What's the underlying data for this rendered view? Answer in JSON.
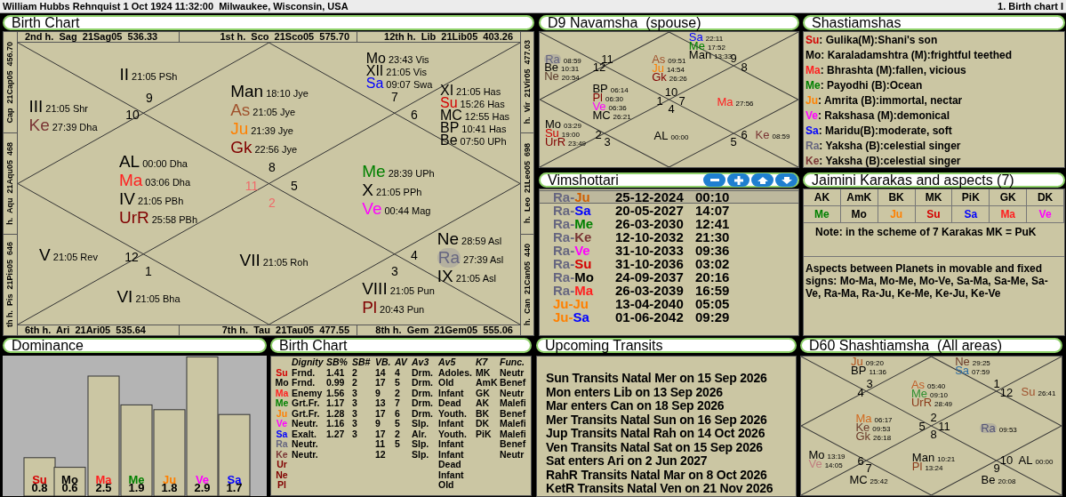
{
  "header": {
    "title": "William Hubbs Rehnquist 1 Oct 1924 11:32:00  Milwaukee, Wisconsin, USA",
    "chart_name": "1. Birth chart I"
  },
  "birth_chart": {
    "title": "Birth Chart",
    "top_labels": [
      "2nd h.  Sag  21Sag05  536.33",
      "1st h.  Sco  21Sco05  575.70",
      "12th h.  Lib  21Lib05  403.26"
    ],
    "bottom_labels": [
      "6th h.  Ari  21Ari05  535.64",
      "7th h.  Tau  21Tau05  477.55",
      "8th h.  Gem  21Gem05  555.06"
    ],
    "left_labels": [
      "Cap  21Cap05  456.70",
      "h.  Aqu  21Aqu05  468",
      "th h.  Pis  21Pis05  646"
    ],
    "right_labels": [
      "h.  Vir  21Vir05  477.03",
      "h.  Leo  21Leo05  698",
      "h.  Can  21Can05  440"
    ],
    "houses": [
      {
        "sign": "9",
        "color": "#000000",
        "planets": [
          {
            "abbr": "II",
            "detail": "21:05 PSh",
            "color": "#000000",
            "highlighted": false
          }
        ]
      },
      {
        "sign": "7",
        "color": "#000000",
        "planets": [
          {
            "abbr": "Mo",
            "detail": "23:43 Vis",
            "color": "#000000",
            "highlighted": false
          },
          {
            "abbr": "XII",
            "detail": "21:05 Vis",
            "color": "#000000",
            "highlighted": false
          },
          {
            "abbr": "Sa",
            "detail": "09:07 Swa",
            "color": "#0000ff",
            "highlighted": false
          }
        ]
      },
      {
        "sign": "10",
        "color": "#000000",
        "planets": [
          {
            "abbr": "III",
            "detail": "21:05 Shr",
            "color": "#000000",
            "highlighted": false
          },
          {
            "abbr": "Ke",
            "detail": "27:39 Dha",
            "color": "#7a3535",
            "highlighted": false
          }
        ]
      },
      {
        "sign": "8",
        "color": "#000000",
        "planets": [
          {
            "abbr": "Man",
            "detail": "18:10 Jye",
            "color": "#000000",
            "highlighted": false
          },
          {
            "abbr": "As",
            "detail": "21:05 Jye",
            "color": "#a0522d",
            "highlighted": false
          },
          {
            "abbr": "Ju",
            "detail": "21:39 Jye",
            "color": "#ff8000",
            "highlighted": false
          },
          {
            "abbr": "Gk",
            "detail": "22:56 Jye",
            "color": "#800000",
            "highlighted": false
          }
        ]
      },
      {
        "sign": "6",
        "color": "#000000",
        "planets": [
          {
            "abbr": "XI",
            "detail": "21:05 Has",
            "color": "#000000",
            "highlighted": false
          },
          {
            "abbr": "Su",
            "detail": "15:26 Has",
            "color": "#d40000",
            "highlighted": false
          },
          {
            "abbr": "MC",
            "detail": "12:55 Has",
            "color": "#000000",
            "highlighted": false
          },
          {
            "abbr": "BP",
            "detail": "10:41 Has",
            "color": "#000000",
            "highlighted": false
          },
          {
            "abbr": "Be",
            "detail": "07:50 UPh",
            "color": "#000000",
            "highlighted": false
          }
        ]
      },
      {
        "sign": "11",
        "color": "#f06a6a",
        "planets": [
          {
            "abbr": "AL",
            "detail": "00:00 Dha",
            "color": "#000000",
            "highlighted": false
          },
          {
            "abbr": "Ma",
            "detail": "03:06 Dha",
            "color": "#ff2020",
            "highlighted": false
          },
          {
            "abbr": "IV",
            "detail": "21:05 PBh",
            "color": "#000000",
            "highlighted": false
          },
          {
            "abbr": "UrR",
            "detail": "25:58 PBh",
            "color": "#800000",
            "highlighted": false
          }
        ]
      },
      {
        "sign": "5",
        "color": "#000000",
        "planets": [
          {
            "abbr": "Me",
            "detail": "28:39 UPh",
            "color": "#008000",
            "highlighted": false
          },
          {
            "abbr": "X",
            "detail": "21:05 PPh",
            "color": "#000000",
            "highlighted": false
          },
          {
            "abbr": "Ve",
            "detail": "00:44 Mag",
            "color": "#ff00ff",
            "highlighted": false
          }
        ]
      },
      {
        "sign": "12",
        "color": "#000000",
        "planets": [
          {
            "abbr": "V",
            "detail": "21:05 Rev",
            "color": "#000000",
            "highlighted": false
          }
        ]
      },
      {
        "sign": "2",
        "color": "#f06a6a",
        "planets": [
          {
            "abbr": "VII",
            "detail": "21:05 Roh",
            "color": "#000000",
            "highlighted": false
          }
        ]
      },
      {
        "sign": "4",
        "color": "#000000",
        "planets": [
          {
            "abbr": "Ne",
            "detail": "28:59 Asl",
            "color": "#000000",
            "highlighted": false
          },
          {
            "abbr": "Ra",
            "detail": "27:39 Asl",
            "color": "#666680",
            "highlighted": true
          },
          {
            "abbr": "IX",
            "detail": "21:05 Asl",
            "color": "#000000",
            "highlighted": false
          }
        ]
      },
      {
        "sign": "1",
        "color": "#000000",
        "planets": [
          {
            "abbr": "VI",
            "detail": "21:05 Bha",
            "color": "#000000",
            "highlighted": false
          }
        ]
      },
      {
        "sign": "3",
        "color": "#000000",
        "planets": [
          {
            "abbr": "VIII",
            "detail": "21:05 Pun",
            "color": "#000000",
            "highlighted": false
          },
          {
            "abbr": "Pl",
            "detail": "20:43 Pun",
            "color": "#800000",
            "highlighted": false
          }
        ]
      }
    ]
  },
  "d9": {
    "title": "D9 Navamsha  (spouse)",
    "houses": [
      {
        "sign": "11",
        "color": "#000000"
      },
      {
        "sign": "9",
        "color": "#000000",
        "planets": [
          {
            "abbr": "Sa",
            "detail": "22:11",
            "color": "#0000ff",
            "highlighted": false
          },
          {
            "abbr": "Me",
            "detail": "17:52",
            "color": "#008000",
            "highlighted": false
          },
          {
            "abbr": "Man",
            "detail": "13:33",
            "color": "#000000",
            "highlighted": false
          }
        ]
      },
      {
        "sign": "12",
        "color": "#000000",
        "planets": [
          {
            "abbr": "Ra",
            "detail": "08:59",
            "color": "#666680",
            "highlighted": true
          },
          {
            "abbr": "Be",
            "detail": "10:31",
            "color": "#000000",
            "highlighted": false
          },
          {
            "abbr": "Ne",
            "detail": "20:54",
            "color": "#5a3a2a",
            "highlighted": false
          }
        ]
      },
      {
        "sign": "10",
        "color": "#000000",
        "planets": [
          {
            "abbr": "As",
            "detail": "09:51",
            "color": "#a0522d",
            "highlighted": false
          },
          {
            "abbr": "Ju",
            "detail": "14:54",
            "color": "#ff8000",
            "highlighted": false
          },
          {
            "abbr": "Gk",
            "detail": "26:26",
            "color": "#800000",
            "highlighted": false
          }
        ]
      },
      {
        "sign": "8",
        "color": "#000000"
      },
      {
        "sign": "1",
        "color": "#000000",
        "planets": [
          {
            "abbr": "BP",
            "detail": "06:14",
            "color": "#000000",
            "highlighted": false
          },
          {
            "abbr": "Pl",
            "detail": "06:30",
            "color": "#800000",
            "highlighted": false
          },
          {
            "abbr": "Ve",
            "detail": "06:36",
            "color": "#ff00ff",
            "highlighted": false
          },
          {
            "abbr": "MC",
            "detail": "26:21",
            "color": "#000000",
            "highlighted": false
          }
        ]
      },
      {
        "sign": "7",
        "color": "#000000",
        "planets": [
          {
            "abbr": "Ma",
            "detail": "27:56",
            "color": "#ff2020",
            "highlighted": false
          }
        ]
      },
      {
        "sign": "2",
        "color": "#000000",
        "planets": [
          {
            "abbr": "Mo",
            "detail": "03:29",
            "color": "#000000",
            "highlighted": false
          },
          {
            "abbr": "Su",
            "detail": "19:00",
            "color": "#cc0000",
            "highlighted": false
          },
          {
            "abbr": "UrR",
            "detail": "23:49",
            "color": "#800000",
            "highlighted": false
          }
        ]
      },
      {
        "sign": "4",
        "color": "#000000",
        "planets": [
          {
            "abbr": "AL",
            "detail": "00:00",
            "color": "#000000",
            "highlighted": false
          }
        ]
      },
      {
        "sign": "6",
        "color": "#000000",
        "planets": [
          {
            "abbr": "Ke",
            "detail": "08:59",
            "color": "#7a3535",
            "highlighted": false
          }
        ]
      },
      {
        "sign": "3",
        "color": "#000000"
      },
      {
        "sign": "5",
        "color": "#000000"
      }
    ]
  },
  "vimshottari": {
    "title": "Vimshottari",
    "rows": [
      {
        "parts": [
          {
            "text": "Ra-",
            "color": "#666680"
          },
          {
            "text": "Ju",
            "color": "#d05f00"
          }
        ],
        "date": "25-12-2024",
        "time": "00:10",
        "selected": true
      },
      {
        "parts": [
          {
            "text": "Ra-",
            "color": "#666680"
          },
          {
            "text": "Sa",
            "color": "#0000ff"
          }
        ],
        "date": "20-05-2027",
        "time": "14:07",
        "selected": false
      },
      {
        "parts": [
          {
            "text": "Ra-",
            "color": "#666680"
          },
          {
            "text": "Me",
            "color": "#008000"
          }
        ],
        "date": "26-03-2030",
        "time": "12:41",
        "selected": false
      },
      {
        "parts": [
          {
            "text": "Ra-",
            "color": "#666680"
          },
          {
            "text": "Ke",
            "color": "#7a3535"
          }
        ],
        "date": "12-10-2032",
        "time": "21:30",
        "selected": false
      },
      {
        "parts": [
          {
            "text": "Ra-",
            "color": "#666680"
          },
          {
            "text": "Ve",
            "color": "#ff00ff"
          }
        ],
        "date": "31-10-2033",
        "time": "09:36",
        "selected": false
      },
      {
        "parts": [
          {
            "text": "Ra-",
            "color": "#666680"
          },
          {
            "text": "Su",
            "color": "#d40000"
          }
        ],
        "date": "31-10-2036",
        "time": "03:02",
        "selected": false
      },
      {
        "parts": [
          {
            "text": "Ra-",
            "color": "#666680"
          },
          {
            "text": "Mo",
            "color": "#000000"
          }
        ],
        "date": "24-09-2037",
        "time": "20:16",
        "selected": false
      },
      {
        "parts": [
          {
            "text": "Ra-",
            "color": "#666680"
          },
          {
            "text": "Ma",
            "color": "#ff2020"
          }
        ],
        "date": "26-03-2039",
        "time": "16:59",
        "selected": false
      },
      {
        "parts": [
          {
            "text": "Ju-Ju",
            "color": "#ff8000"
          }
        ],
        "date": "13-04-2040",
        "time": "05:05",
        "selected": false
      },
      {
        "parts": [
          {
            "text": "Ju-",
            "color": "#ff8000"
          },
          {
            "text": "Sa",
            "color": "#0000ff"
          }
        ],
        "date": "01-06-2042",
        "time": "09:29",
        "selected": false
      }
    ]
  },
  "shastiamshas": {
    "title": "Shastiamshas",
    "lines": [
      {
        "planet": "Su",
        "color": "#d40000",
        "text": ": Gulika(M):Shani's son"
      },
      {
        "planet": "Mo",
        "color": "#000000",
        "text": ": Karaladamshtra (M):frightful teethed"
      },
      {
        "planet": "Ma",
        "color": "#ff2020",
        "text": ": Bhrashta (M):fallen, vicious"
      },
      {
        "planet": "Me",
        "color": "#008000",
        "text": ": Payodhi (B):Ocean"
      },
      {
        "planet": "Ju",
        "color": "#ff8000",
        "text": ": Amrita (B):immortal, nectar"
      },
      {
        "planet": "Ve",
        "color": "#ff00ff",
        "text": ": Rakshasa (M):demonical"
      },
      {
        "planet": "Sa",
        "color": "#0000ff",
        "text": ": Maridu(B):moderate, soft"
      },
      {
        "planet": "Ra",
        "color": "#666680",
        "text": ": Yaksha (B):celestial singer"
      },
      {
        "planet": "Ke",
        "color": "#7a3535",
        "text": ": Yaksha (B):celestial singer"
      }
    ]
  },
  "jaimini": {
    "title": "Jaimini Karakas and aspects (7)",
    "karakas": [
      {
        "name": "AK",
        "planet": "Me",
        "color": "#008000"
      },
      {
        "name": "AmK",
        "planet": "Mo",
        "color": "#000000"
      },
      {
        "name": "BK",
        "planet": "Ju",
        "color": "#ff8000"
      },
      {
        "name": "MK",
        "planet": "Su",
        "color": "#d40000"
      },
      {
        "name": "PiK",
        "planet": "Sa",
        "color": "#0000ff"
      },
      {
        "name": "GK",
        "planet": "Ma",
        "color": "#ff2020"
      },
      {
        "name": "DK",
        "planet": "Ve",
        "color": "#ff00ff"
      }
    ],
    "note": "Note: in the scheme of 7 Karakas MK = PuK",
    "aspects": "Aspects between Planets in movable and fixed signs: Mo-Ma, Mo-Me, Mo-Ve, Sa-Ma, Sa-Me, Sa-Ve, Ra-Ma, Ra-Ju, Ke-Me, Ke-Ju, Ke-Ve"
  },
  "dominance": {
    "title": "Dominance",
    "label_colors": [
      {
        "color": "#d40000"
      },
      {
        "color": "#000000"
      },
      {
        "color": "#ff2020"
      },
      {
        "color": "#008000"
      },
      {
        "color": "#ff8000"
      },
      {
        "color": "#ff00ff"
      },
      {
        "color": "#0000ff"
      }
    ],
    "chart_data": {
      "type": "bar",
      "categories": [
        "Su",
        "Mo",
        "Ma",
        "Me",
        "Ju",
        "Ve",
        "Sa"
      ],
      "values": [
        0.8,
        0.6,
        2.5,
        1.9,
        1.8,
        2.9,
        1.7
      ],
      "value_labels": [
        "0.8",
        "0.6",
        "2.5",
        "1.9",
        "1.8",
        "2.9",
        "1.7"
      ]
    }
  },
  "dignity_table": {
    "title": "Birth Chart",
    "columns": [
      "Dignity",
      "SB%",
      "SB#",
      "VB.",
      "AV",
      "Av3",
      "Av5",
      "K7",
      "Func."
    ],
    "rows": [
      {
        "planet": "Su",
        "color": "#d40000",
        "cells": [
          "Frnd.",
          "1.41",
          "2",
          "14",
          "4",
          "Drm.",
          "Adoles.",
          "MK",
          "Neutr"
        ]
      },
      {
        "planet": "Mo",
        "color": "#000000",
        "cells": [
          "Frnd.",
          "0.99",
          "2",
          "17",
          "5",
          "Drm.",
          "Old",
          "AmK",
          "Benef"
        ]
      },
      {
        "planet": "Ma",
        "color": "#ff2020",
        "cells": [
          "Enemy",
          "1.56",
          "3",
          "9",
          "2",
          "Drm.",
          "Infant",
          "GK",
          "Neutr"
        ]
      },
      {
        "planet": "Me",
        "color": "#008000",
        "cells": [
          "Grt.Fr.",
          "1.17",
          "3",
          "13",
          "7",
          "Drm.",
          "Dead",
          "AK",
          "Malefi"
        ]
      },
      {
        "planet": "Ju",
        "color": "#ff8000",
        "cells": [
          "Grt.Fr.",
          "1.28",
          "3",
          "17",
          "6",
          "Drm.",
          "Youth.",
          "BK",
          "Benef"
        ]
      },
      {
        "planet": "Ve",
        "color": "#ff00ff",
        "cells": [
          "Neutr.",
          "1.16",
          "3",
          "9",
          "5",
          "Slp.",
          "Infant",
          "DK",
          "Malefi"
        ]
      },
      {
        "planet": "Sa",
        "color": "#0000ff",
        "cells": [
          "Exalt.",
          "1.27",
          "3",
          "17",
          "2",
          "Alr.",
          "Youth.",
          "PiK",
          "Malefi"
        ]
      },
      {
        "planet": "Ra",
        "color": "#666680",
        "cells": [
          "Neutr.",
          null,
          null,
          "11",
          "5",
          "Slp.",
          "Infant",
          null,
          "Benef"
        ]
      },
      {
        "planet": "Ke",
        "color": "#7a3535",
        "cells": [
          "Neutr.",
          null,
          null,
          "12",
          null,
          "Slp.",
          "Infant",
          null,
          "Neutr"
        ]
      },
      {
        "planet": "Ur",
        "color": "#800000",
        "cells": [
          null,
          null,
          null,
          null,
          null,
          null,
          "Dead",
          null,
          null
        ]
      },
      {
        "planet": "Ne",
        "color": "#800000",
        "cells": [
          null,
          null,
          null,
          null,
          null,
          null,
          "Infant",
          null,
          null
        ]
      },
      {
        "planet": "Pl",
        "color": "#800000",
        "cells": [
          null,
          null,
          null,
          null,
          null,
          null,
          "Old",
          null,
          null
        ]
      }
    ]
  },
  "transits": {
    "title": "Upcoming Transits",
    "lines": [
      "Sun Transits Natal Mer on 15 Sep 2026",
      "Mon enters Lib on 13 Sep 2026",
      "Mar enters Can on 18 Sep 2026",
      "Mer Transits Natal Sun on 16 Sep 2026",
      "Jup Transits Natal Rah on 14 Oct 2026",
      "Ven Transits Natal Sat on 15 Sep 2026",
      "Sat enters Ari on 2 Jun 2027",
      "RahR Transits Natal Mar on 8 Oct 2026",
      "KetR Transits Natal Ven on 21 Nov 2026"
    ]
  },
  "d60": {
    "title": "D60 Shashtiamsha  (All areas)",
    "houses": [
      {
        "sign": "3",
        "color": "#000000",
        "planets": [
          {
            "abbr": "Ju",
            "detail": "09:20",
            "color": "#b0501a",
            "highlighted": false
          },
          {
            "abbr": "BP",
            "detail": "11:36",
            "color": "#000000",
            "highlighted": false
          }
        ]
      },
      {
        "sign": "1",
        "color": "#000000",
        "planets": [
          {
            "abbr": "Ne",
            "detail": "29:25",
            "color": "#6b3b2b",
            "highlighted": false
          },
          {
            "abbr": "Sa",
            "detail": "07:59",
            "color": "#2e6da4",
            "highlighted": false
          }
        ]
      },
      {
        "sign": "4",
        "color": "#000000"
      },
      {
        "sign": "2",
        "color": "#000000",
        "planets": [
          {
            "abbr": "As",
            "detail": "05:40",
            "color": "#c0602a",
            "highlighted": false
          },
          {
            "abbr": "Me",
            "detail": "09:10",
            "color": "#2f8f2f",
            "highlighted": false
          },
          {
            "abbr": "UrR",
            "detail": "28:49",
            "color": "#8b3a1a",
            "highlighted": false
          }
        ]
      },
      {
        "sign": "12",
        "color": "#000000",
        "planets": [
          {
            "abbr": "Su",
            "detail": "26:41",
            "color": "#a0522d",
            "highlighted": false
          }
        ]
      },
      {
        "sign": "5",
        "color": "#000000",
        "planets": [
          {
            "abbr": "Ma",
            "detail": "06:17",
            "color": "#d2691e",
            "highlighted": false
          },
          {
            "abbr": "Ke",
            "detail": "09:53",
            "color": "#6b3b2b",
            "highlighted": false
          },
          {
            "abbr": "Gk",
            "detail": "26:18",
            "color": "#6b3b2b",
            "highlighted": false
          }
        ]
      },
      {
        "sign": "11",
        "color": "#000000",
        "planets": [
          {
            "abbr": "Ra",
            "detail": "09:53",
            "color": "#555577",
            "highlighted": true
          }
        ]
      },
      {
        "sign": "6",
        "color": "#000000",
        "planets": [
          {
            "abbr": "Mo",
            "detail": "13:19",
            "color": "#000000",
            "highlighted": false
          },
          {
            "abbr": "Ve",
            "detail": "14:05",
            "color": "#c07f7f",
            "highlighted": false
          }
        ]
      },
      {
        "sign": "8",
        "color": "#000000",
        "planets": [
          {
            "abbr": "Man",
            "detail": "10:21",
            "color": "#000000",
            "highlighted": false
          },
          {
            "abbr": "Pl",
            "detail": "13:24",
            "color": "#8b3a1a",
            "highlighted": false
          }
        ]
      },
      {
        "sign": "10",
        "color": "#000000",
        "planets": [
          {
            "abbr": "AL",
            "detail": "00:00",
            "color": "#000000",
            "highlighted": false
          }
        ]
      },
      {
        "sign": "7",
        "color": "#000000",
        "planets": [
          {
            "abbr": "MC",
            "detail": "25:42",
            "color": "#000000",
            "highlighted": false
          }
        ]
      },
      {
        "sign": "9",
        "color": "#000000",
        "planets": [
          {
            "abbr": "Be",
            "detail": "20:08",
            "color": "#000000",
            "highlighted": false
          }
        ]
      }
    ]
  }
}
